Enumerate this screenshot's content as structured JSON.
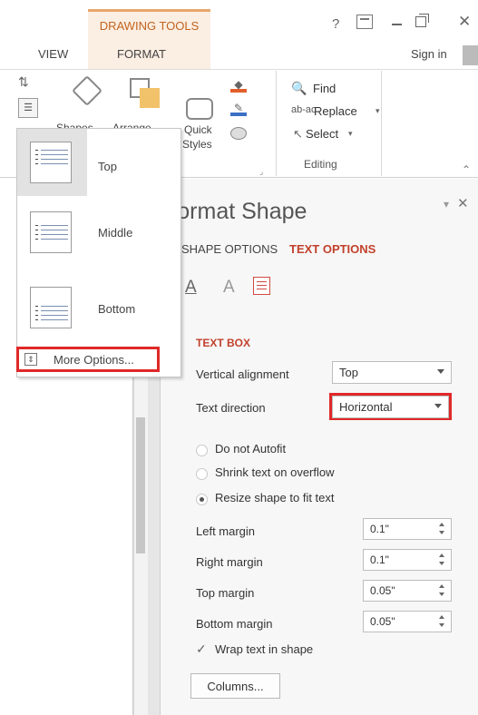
{
  "titlebar": {
    "contextual_tab_group": "DRAWING TOOLS",
    "tabs": [
      {
        "label": "VIEW"
      },
      {
        "label": "FORMAT"
      }
    ],
    "help": "?",
    "sign_in": "Sign in",
    "close_glyph": "✕"
  },
  "ribbon": {
    "find_icon": "binoculars-icon",
    "find": "Find",
    "replace_icon": "ab-ac",
    "replace": "Replace",
    "select_icon": "cursor-icon",
    "select": "Select",
    "group_label": "Editing",
    "shapes_label": "Shapes",
    "arrange_label": "Arrange",
    "quick_label": "Quick",
    "styles_label": "Styles"
  },
  "align_dropdown": {
    "options": [
      {
        "label": "Top",
        "selected": true
      },
      {
        "label": "Middle",
        "selected": false
      },
      {
        "label": "Bottom",
        "selected": false
      }
    ],
    "more": "More Options..."
  },
  "format_pane": {
    "title": "Format Shape",
    "tabs": [
      {
        "label": "SHAPE OPTIONS",
        "active": false
      },
      {
        "label": "TEXT OPTIONS",
        "active": true
      }
    ],
    "section": "TEXT BOX",
    "vertical_alignment": {
      "label": "Vertical alignment",
      "value": "Top"
    },
    "text_direction": {
      "label": "Text direction",
      "value": "Horizontal"
    },
    "autofit": [
      {
        "label": "Do not Autofit",
        "checked": false
      },
      {
        "label": "Shrink text on overflow",
        "checked": false
      },
      {
        "label": "Resize shape to fit text",
        "checked": true
      }
    ],
    "margins": [
      {
        "label": "Left margin",
        "value": "0.1\""
      },
      {
        "label": "Right margin",
        "value": "0.1\""
      },
      {
        "label": "Top margin",
        "value": "0.05\""
      },
      {
        "label": "Bottom margin",
        "value": "0.05\""
      }
    ],
    "wrap_text": {
      "label": "Wrap text in shape",
      "checked": true
    },
    "columns_button": "Columns..."
  },
  "colors": {
    "accent": "#c2412c",
    "highlight": "#e02828",
    "contextual": "#c2631f"
  }
}
